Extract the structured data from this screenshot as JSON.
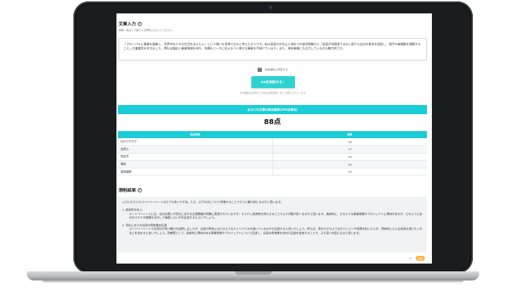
{
  "input_section": {
    "title": "文章入力",
    "subtitle": "添削・採点して欲しい文章を入力してください。",
    "essay_text": "「グローバルに事業を展開し、世界中の人々の生活を支えたい」という想いを実現できると考えたからです。私は英語力の向上と海外での留学経験から「英語が母国語ではない国でも自分の意見を発信し、相手の価値観を理解すること」の重要性を学びました。貴社は幅広い事業領域を持ち、各種もニーズに応えるべく様々な事業を手掛けています。また、海外事業にも注力している点も魅力的です。",
    "checkbox_label": "利用規約に同意する",
    "checkbox_checked": true,
    "submit_label": "ESを添削する",
    "submit_arrow": "›",
    "note": "※AI添削は文章の入力後は利用規約において禁止されています"
  },
  "result": {
    "header": "あなたの文章の採点結果(100点満点)",
    "score": "88点",
    "columns": [
      "採点項目",
      "点数"
    ],
    "rows": [
      {
        "criterion": "伝わりやすさ",
        "score": "18"
      },
      {
        "criterion": "説得力",
        "score": "17"
      },
      {
        "criterion": "独自性",
        "score": "19"
      },
      {
        "criterion": "構成",
        "score": "20"
      },
      {
        "criterion": "論理展開",
        "score": "20"
      }
    ]
  },
  "feedback": {
    "title": "添削結果",
    "intro": "入力いただいたエントリーシートはとても良いですね。ただ、以下の点について改善することでさらに魅力的になるかと思います。",
    "point1_title": "1. 具体性の向上:",
    "point1_text": "エントリーシートには、自分の想いや貴社に対する志望動機が明確に表現されていますが、もう少し具体性を持たせることでより印象が良くなるかと思います。具体的に、どのような事業領域やプロジェクトに興味があるか、どのように自分のスキルや経験を活かして貢献したいかを記述するとよいでしょう。",
    "point2_title": "2. 貴社における自身の将来像の記述:",
    "point2_text": "エントリーシートでは貴社が持つ魅力を説明しましたが、自身が将来にはどのようなキャリアパスを描いているのかも記述すると良いでしょう。例えば、貴社でどのようなポジションや役割を担いたいか、将来的にどんな成長を遂げたいかなどを含めると良いでしょう。改善策として、具体的に興味のある事業領域やプロジェクトについて記述し、自身の将来像を含めた記述を追加することで、より深い内容になると思います。",
    "bottom_label": "ｺﾋﾟｰ",
    "bottom_button": "送信"
  },
  "colors": {
    "accent": "#1bcdd6",
    "button": "#2ed3cf",
    "pill": "#ffb23b",
    "frame": "#1b1c1e"
  }
}
